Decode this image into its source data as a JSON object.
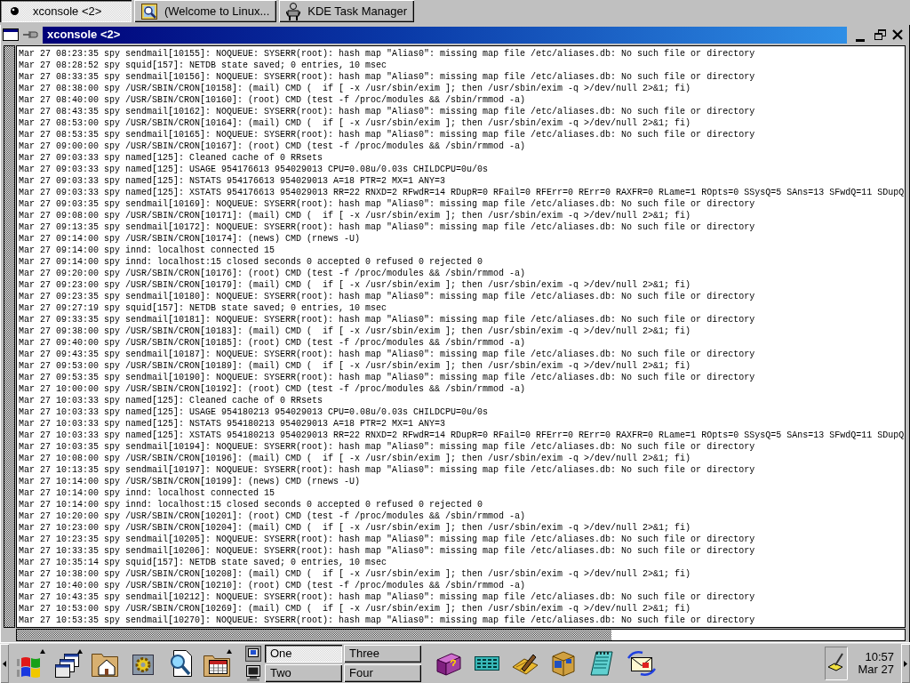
{
  "top_taskbar": {
    "tasks": [
      {
        "label": "xconsole <2>",
        "selected": true
      },
      {
        "label": "(Welcome to Linux...",
        "selected": false
      },
      {
        "label": "KDE Task Manager",
        "selected": false
      }
    ]
  },
  "window": {
    "title": "xconsole <2>",
    "lines": [
      "Mar 27 08:23:35 spy sendmail[10155]: NOQUEUE: SYSERR(root): hash map \"Alias0\": missing map file /etc/aliases.db: No such file or directory",
      "Mar 27 08:28:52 spy squid[157]: NETDB state saved; 0 entries, 10 msec",
      "Mar 27 08:33:35 spy sendmail[10156]: NOQUEUE: SYSERR(root): hash map \"Alias0\": missing map file /etc/aliases.db: No such file or directory",
      "Mar 27 08:38:00 spy /USR/SBIN/CRON[10158]: (mail) CMD (  if [ -x /usr/sbin/exim ]; then /usr/sbin/exim -q >/dev/null 2>&1; fi)",
      "Mar 27 08:40:00 spy /USR/SBIN/CRON[10160]: (root) CMD (test -f /proc/modules && /sbin/rmmod -a)",
      "Mar 27 08:43:35 spy sendmail[10162]: NOQUEUE: SYSERR(root): hash map \"Alias0\": missing map file /etc/aliases.db: No such file or directory",
      "Mar 27 08:53:00 spy /USR/SBIN/CRON[10164]: (mail) CMD (  if [ -x /usr/sbin/exim ]; then /usr/sbin/exim -q >/dev/null 2>&1; fi)",
      "Mar 27 08:53:35 spy sendmail[10165]: NOQUEUE: SYSERR(root): hash map \"Alias0\": missing map file /etc/aliases.db: No such file or directory",
      "Mar 27 09:00:00 spy /USR/SBIN/CRON[10167]: (root) CMD (test -f /proc/modules && /sbin/rmmod -a)",
      "Mar 27 09:03:33 spy named[125]: Cleaned cache of 0 RRsets",
      "Mar 27 09:03:33 spy named[125]: USAGE 954176613 954029013 CPU=0.08u/0.03s CHILDCPU=0u/0s",
      "Mar 27 09:03:33 spy named[125]: NSTATS 954176613 954029013 A=18 PTR=2 MX=1 ANY=3",
      "Mar 27 09:03:33 spy named[125]: XSTATS 954176613 954029013 RR=22 RNXD=2 RFwdR=14 RDupR=0 RFail=0 RFErr=0 RErr=0 RAXFR=0 RLame=1 ROpts=0 SSysQ=5 SAns=13 SFwdQ=11 SDupQ",
      "Mar 27 09:03:35 spy sendmail[10169]: NOQUEUE: SYSERR(root): hash map \"Alias0\": missing map file /etc/aliases.db: No such file or directory",
      "Mar 27 09:08:00 spy /USR/SBIN/CRON[10171]: (mail) CMD (  if [ -x /usr/sbin/exim ]; then /usr/sbin/exim -q >/dev/null 2>&1; fi)",
      "Mar 27 09:13:35 spy sendmail[10172]: NOQUEUE: SYSERR(root): hash map \"Alias0\": missing map file /etc/aliases.db: No such file or directory",
      "Mar 27 09:14:00 spy /USR/SBIN/CRON[10174]: (news) CMD (rnews -U)",
      "Mar 27 09:14:00 spy innd: localhost connected 15",
      "Mar 27 09:14:00 spy innd: localhost:15 closed seconds 0 accepted 0 refused 0 rejected 0",
      "Mar 27 09:20:00 spy /USR/SBIN/CRON[10176]: (root) CMD (test -f /proc/modules && /sbin/rmmod -a)",
      "Mar 27 09:23:00 spy /USR/SBIN/CRON[10179]: (mail) CMD (  if [ -x /usr/sbin/exim ]; then /usr/sbin/exim -q >/dev/null 2>&1; fi)",
      "Mar 27 09:23:35 spy sendmail[10180]: NOQUEUE: SYSERR(root): hash map \"Alias0\": missing map file /etc/aliases.db: No such file or directory",
      "Mar 27 09:27:19 spy squid[157]: NETDB state saved; 0 entries, 10 msec",
      "Mar 27 09:33:35 spy sendmail[10181]: NOQUEUE: SYSERR(root): hash map \"Alias0\": missing map file /etc/aliases.db: No such file or directory",
      "Mar 27 09:38:00 spy /USR/SBIN/CRON[10183]: (mail) CMD (  if [ -x /usr/sbin/exim ]; then /usr/sbin/exim -q >/dev/null 2>&1; fi)",
      "Mar 27 09:40:00 spy /USR/SBIN/CRON[10185]: (root) CMD (test -f /proc/modules && /sbin/rmmod -a)",
      "Mar 27 09:43:35 spy sendmail[10187]: NOQUEUE: SYSERR(root): hash map \"Alias0\": missing map file /etc/aliases.db: No such file or directory",
      "Mar 27 09:53:00 spy /USR/SBIN/CRON[10189]: (mail) CMD (  if [ -x /usr/sbin/exim ]; then /usr/sbin/exim -q >/dev/null 2>&1; fi)",
      "Mar 27 09:53:35 spy sendmail[10190]: NOQUEUE: SYSERR(root): hash map \"Alias0\": missing map file /etc/aliases.db: No such file or directory",
      "Mar 27 10:00:00 spy /USR/SBIN/CRON[10192]: (root) CMD (test -f /proc/modules && /sbin/rmmod -a)",
      "Mar 27 10:03:33 spy named[125]: Cleaned cache of 0 RRsets",
      "Mar 27 10:03:33 spy named[125]: USAGE 954180213 954029013 CPU=0.08u/0.03s CHILDCPU=0u/0s",
      "Mar 27 10:03:33 spy named[125]: NSTATS 954180213 954029013 A=18 PTR=2 MX=1 ANY=3",
      "Mar 27 10:03:33 spy named[125]: XSTATS 954180213 954029013 RR=22 RNXD=2 RFwdR=14 RDupR=0 RFail=0 RFErr=0 RErr=0 RAXFR=0 RLame=1 ROpts=0 SSysQ=5 SAns=13 SFwdQ=11 SDupQ",
      "Mar 27 10:03:35 spy sendmail[10194]: NOQUEUE: SYSERR(root): hash map \"Alias0\": missing map file /etc/aliases.db: No such file or directory",
      "Mar 27 10:08:00 spy /USR/SBIN/CRON[10196]: (mail) CMD (  if [ -x /usr/sbin/exim ]; then /usr/sbin/exim -q >/dev/null 2>&1; fi)",
      "Mar 27 10:13:35 spy sendmail[10197]: NOQUEUE: SYSERR(root): hash map \"Alias0\": missing map file /etc/aliases.db: No such file or directory",
      "Mar 27 10:14:00 spy /USR/SBIN/CRON[10199]: (news) CMD (rnews -U)",
      "Mar 27 10:14:00 spy innd: localhost connected 15",
      "Mar 27 10:14:00 spy innd: localhost:15 closed seconds 0 accepted 0 refused 0 rejected 0",
      "Mar 27 10:20:00 spy /USR/SBIN/CRON[10201]: (root) CMD (test -f /proc/modules && /sbin/rmmod -a)",
      "Mar 27 10:23:00 spy /USR/SBIN/CRON[10204]: (mail) CMD (  if [ -x /usr/sbin/exim ]; then /usr/sbin/exim -q >/dev/null 2>&1; fi)",
      "Mar 27 10:23:35 spy sendmail[10205]: NOQUEUE: SYSERR(root): hash map \"Alias0\": missing map file /etc/aliases.db: No such file or directory",
      "Mar 27 10:33:35 spy sendmail[10206]: NOQUEUE: SYSERR(root): hash map \"Alias0\": missing map file /etc/aliases.db: No such file or directory",
      "Mar 27 10:35:14 spy squid[157]: NETDB state saved; 0 entries, 10 msec",
      "Mar 27 10:38:00 spy /USR/SBIN/CRON[10208]: (mail) CMD (  if [ -x /usr/sbin/exim ]; then /usr/sbin/exim -q >/dev/null 2>&1; fi)",
      "Mar 27 10:40:00 spy /USR/SBIN/CRON[10210]: (root) CMD (test -f /proc/modules && /sbin/rmmod -a)",
      "Mar 27 10:43:35 spy sendmail[10212]: NOQUEUE: SYSERR(root): hash map \"Alias0\": missing map file /etc/aliases.db: No such file or directory",
      "Mar 27 10:53:00 spy /USR/SBIN/CRON[10269]: (mail) CMD (  if [ -x /usr/sbin/exim ]; then /usr/sbin/exim -q >/dev/null 2>&1; fi)",
      "Mar 27 10:53:35 spy sendmail[10270]: NOQUEUE: SYSERR(root): hash map \"Alias0\": missing map file /etc/aliases.db: No such file or directory"
    ]
  },
  "panel": {
    "desktops": [
      {
        "label": "One",
        "selected": true
      },
      {
        "label": "Three",
        "selected": false
      },
      {
        "label": "Two",
        "selected": false
      },
      {
        "label": "Four",
        "selected": false
      }
    ],
    "clock": {
      "time": "10:57",
      "date": "Mar 27"
    }
  }
}
